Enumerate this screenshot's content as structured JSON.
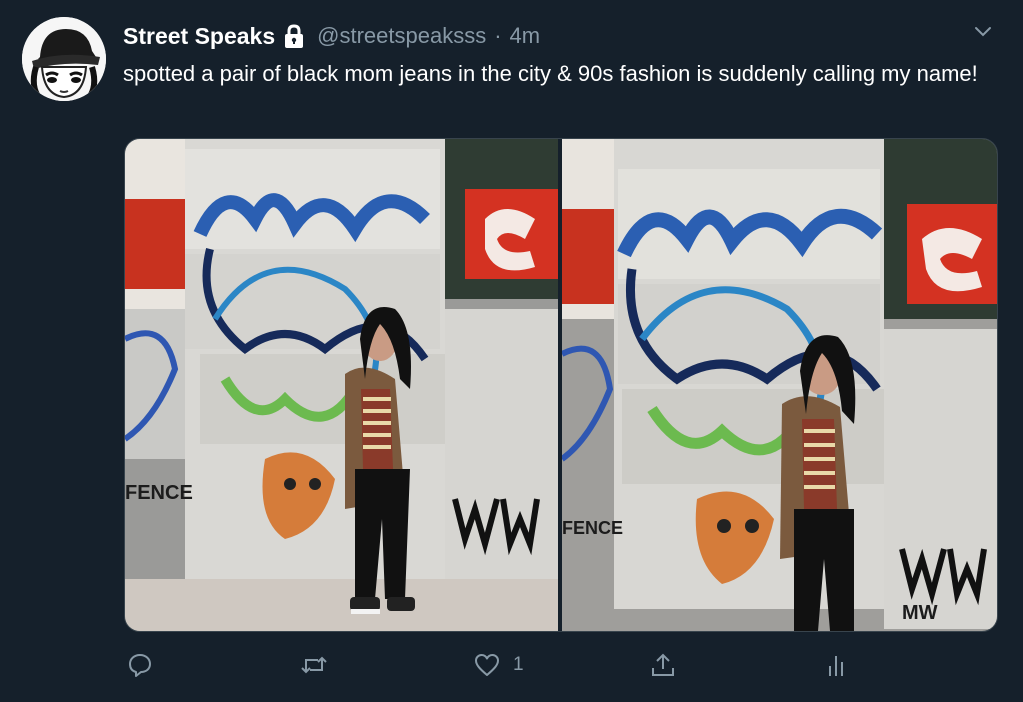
{
  "tweet": {
    "display_name": "Street Speaks",
    "protected_icon": "lock-icon",
    "handle": "@streetspeaksss",
    "separator": "·",
    "timestamp": "4m",
    "text": "spotted a pair of black mom jeans in the city & 90s fashion is suddenly calling my name!",
    "menu_icon": "chevron-down-icon",
    "media": {
      "count": 2,
      "graffiti_texts": [
        "FENCE",
        "MW"
      ]
    }
  },
  "actions": {
    "reply_icon": "reply-icon",
    "retweet_icon": "retweet-icon",
    "like_icon": "heart-icon",
    "like_count": "1",
    "share_icon": "share-icon",
    "analytics_icon": "analytics-icon"
  },
  "colors": {
    "background": "#15202b",
    "secondary_text": "#8899a6",
    "primary_text": "#ffffff",
    "border": "#38444d"
  }
}
